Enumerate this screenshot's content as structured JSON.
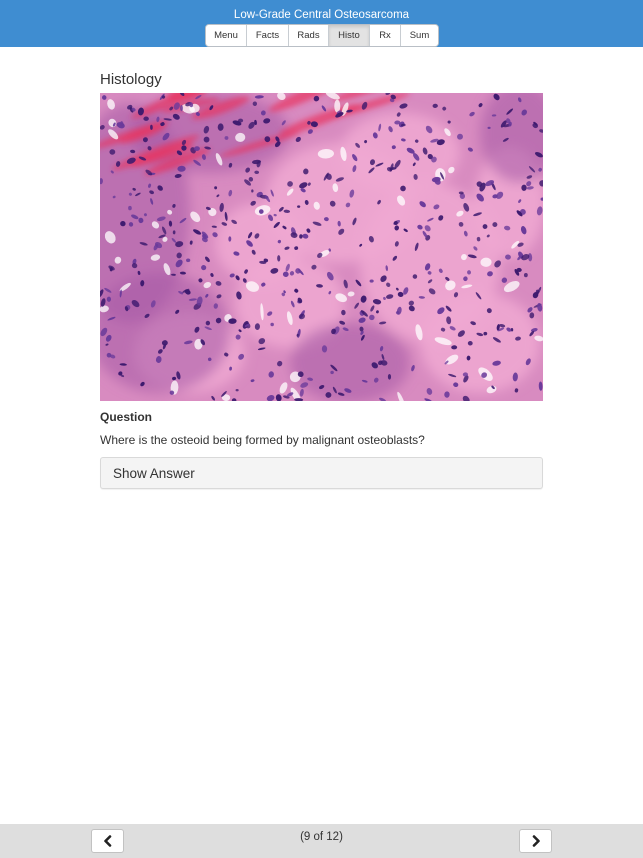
{
  "header": {
    "title": "Low-Grade Central Osteosarcoma",
    "tabs": [
      {
        "label": "Menu",
        "active": false
      },
      {
        "label": "Facts",
        "active": false
      },
      {
        "label": "Rads",
        "active": false
      },
      {
        "label": "Histo",
        "active": true
      },
      {
        "label": "Rx",
        "active": false
      },
      {
        "label": "Sum",
        "active": false
      }
    ],
    "color": "#3f8dd1"
  },
  "content": {
    "section_title": "Histology",
    "image": {
      "subject": "histology-micrograph",
      "stain_colors": [
        "#e49ac9",
        "#5b2a86",
        "#e8355f",
        "#ffffff"
      ]
    },
    "question_label": "Question",
    "question_text": "Where is the osteoid being formed by malignant osteoblasts?",
    "show_answer_label": "Show Answer"
  },
  "footer": {
    "page_indicator": "(9 of 12)",
    "prev_icon": "chevron-left-icon",
    "next_icon": "chevron-right-icon"
  }
}
